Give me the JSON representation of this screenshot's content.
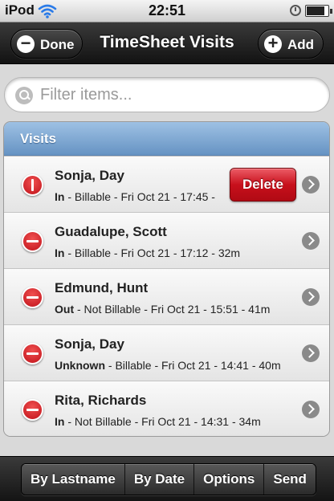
{
  "status_bar": {
    "carrier": "iPod",
    "time": "22:51"
  },
  "header": {
    "title": "TimeSheet Visits",
    "done_label": "Done",
    "add_label": "Add"
  },
  "filter": {
    "placeholder": "Filter items..."
  },
  "list": {
    "divider": "Visits",
    "delete_label": "Delete",
    "items": [
      {
        "name": "Sonja, Day",
        "status": "In",
        "details": " - Billable - Fri Oct 21 - 17:45 -",
        "delete_shown": true
      },
      {
        "name": "Guadalupe, Scott",
        "status": "In",
        "details": " - Billable - Fri Oct 21 - 17:12 - 32m"
      },
      {
        "name": "Edmund, Hunt",
        "status": "Out",
        "details": " - Not Billable - Fri Oct 21 - 15:51 - 41m"
      },
      {
        "name": "Sonja, Day",
        "status": "Unknown",
        "details": " - Billable - Fri Oct 21 - 14:41 - 40m"
      },
      {
        "name": "Rita, Richards",
        "status": "In",
        "details": " - Not Billable - Fri Oct 21 - 14:31 - 34m"
      }
    ]
  },
  "footer": {
    "buttons": [
      "By Lastname",
      "By Date",
      "Options",
      "Send"
    ]
  },
  "colors": {
    "header_dark": "#1b1b1b",
    "divider_blue": "#6693c3",
    "delete_red": "#c8101c",
    "row_icon_red": "#c0121a"
  }
}
